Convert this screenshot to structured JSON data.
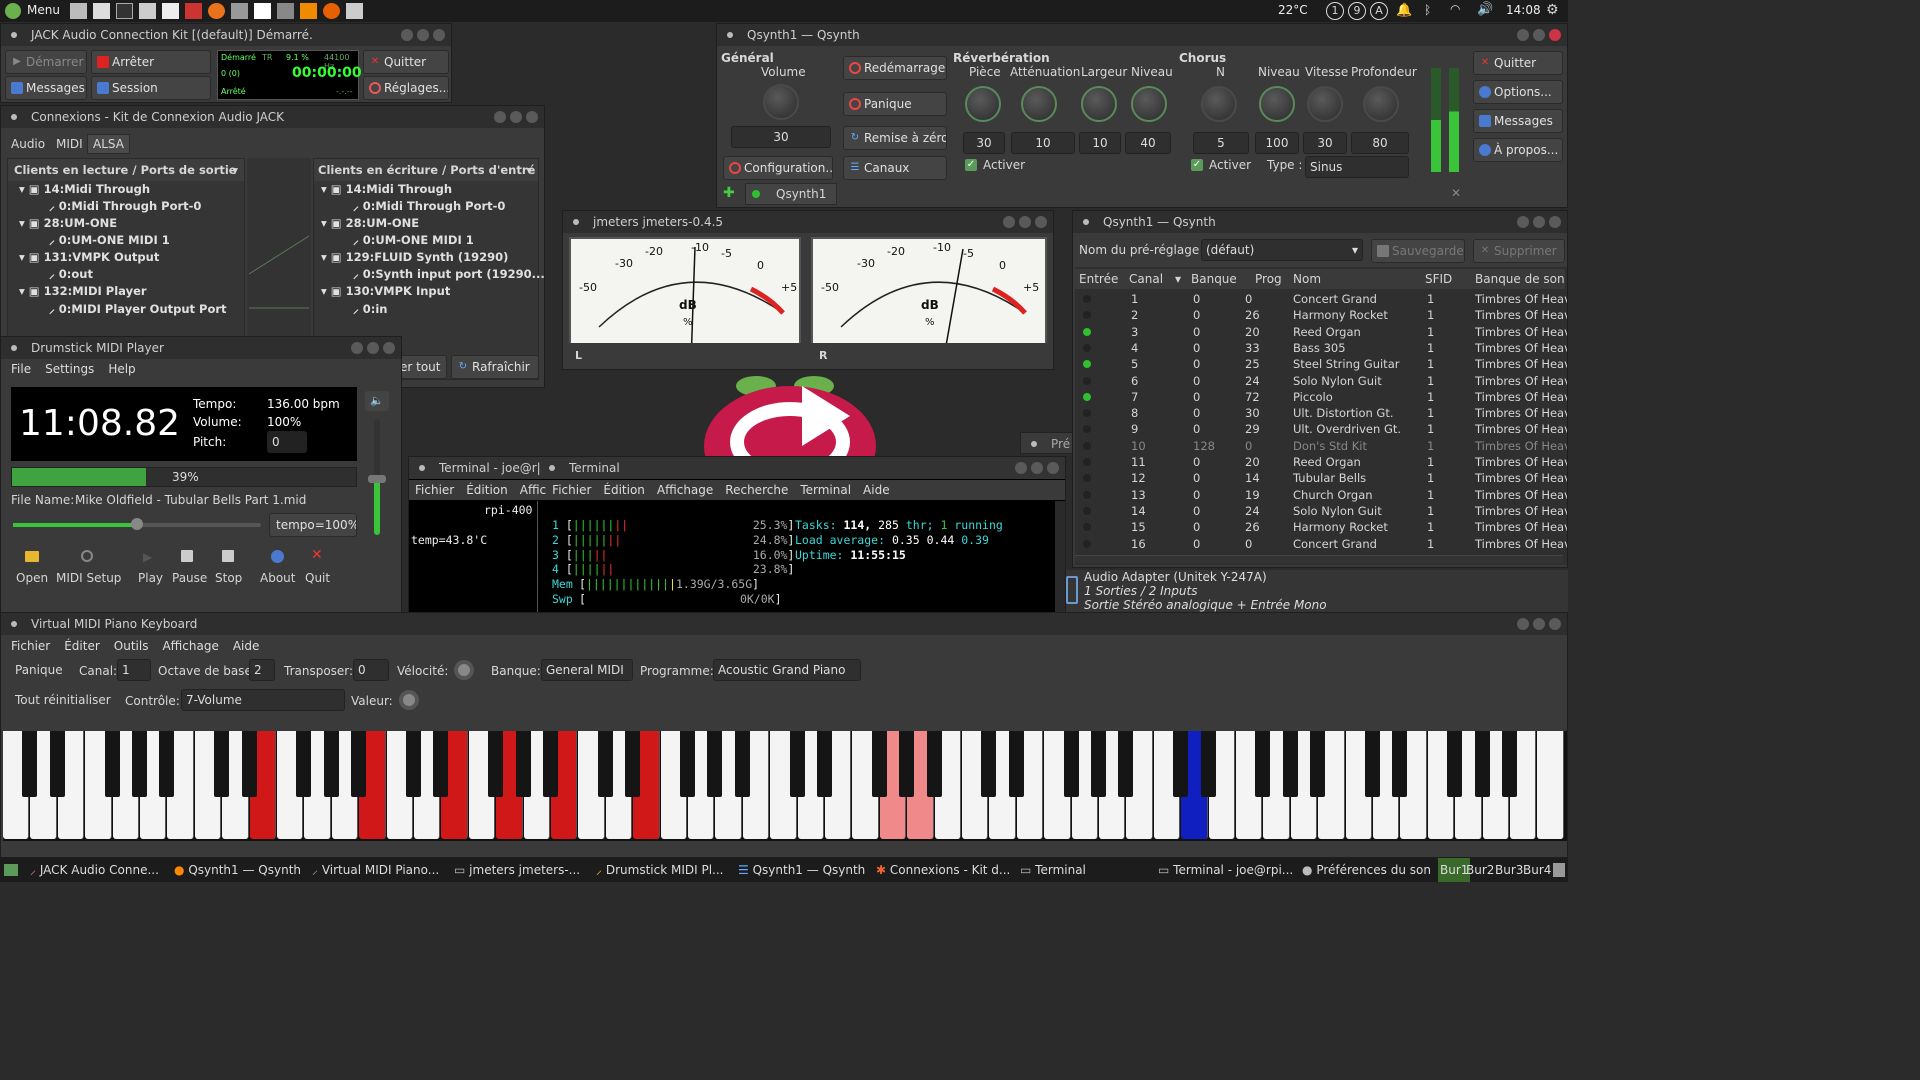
{
  "topbar": {
    "menu": "Menu",
    "temp": "22°C",
    "clock": "14:08",
    "badges": [
      "1",
      "9",
      "A"
    ]
  },
  "jack": {
    "title": "JACK Audio Connection Kit [(default)] Démarré.",
    "start": "Démarrer",
    "stop": "Arrêter",
    "quit": "Quitter",
    "messages": "Messages",
    "session": "Session",
    "settings": "Réglages...",
    "status_started": "Démarré",
    "status_tr": "TR",
    "dsp": "9.1 %",
    "rate": "44100 Hz",
    "xruns": "0 (0)",
    "time": "00:00:00",
    "status_stopped": "Arrêté",
    "latency": "-.-.--"
  },
  "conn": {
    "title": "Connexions - Kit de Connexion Audio JACK",
    "tabs": [
      "Audio",
      "MIDI",
      "ALSA"
    ],
    "readable_header": "Clients en lecture / Ports de sortie",
    "writable_header": "Clients en écriture / Ports d'entré",
    "readable": [
      {
        "client": "14:Midi Through",
        "port": "0:Midi Through Port-0"
      },
      {
        "client": "28:UM-ONE",
        "port": "0:UM-ONE MIDI 1"
      },
      {
        "client": "131:VMPK Output",
        "port": "0:out"
      },
      {
        "client": "132:MIDI Player",
        "port": "0:MIDI Player Output Port"
      }
    ],
    "writable": [
      {
        "client": "14:Midi Through",
        "port": "0:Midi Through Port-0"
      },
      {
        "client": "28:UM-ONE",
        "port": "0:UM-ONE MIDI 1"
      },
      {
        "client": "129:FLUID Synth (19290)",
        "port": "0:Synth input port (19290..."
      },
      {
        "client": "130:VMPK Input",
        "port": "0:in"
      }
    ],
    "disconnect_all": "er tout",
    "refresh": "Rafraîchir"
  },
  "qsynth": {
    "title": "Qsynth1 — Qsynth",
    "general": "Général",
    "volume": "Volume",
    "volume_val": "30",
    "restart": "Redémarrage",
    "panic": "Panique",
    "reset": "Remise à zéro",
    "config": "Configuration...",
    "channels": "Canaux",
    "reverb": "Réverbération",
    "reverb_labels": [
      "Pièce",
      "Atténuation",
      "Largeur",
      "Niveau"
    ],
    "reverb_vals": [
      "30",
      "10",
      "10",
      "40"
    ],
    "chorus": "Chorus",
    "chorus_labels": [
      "N",
      "Niveau",
      "Vitesse",
      "Profondeur"
    ],
    "chorus_vals": [
      "5",
      "100",
      "30",
      "80"
    ],
    "activate": "Activer",
    "type_label": "Type :",
    "type_val": "Sinus",
    "quit": "Quitter",
    "options": "Options...",
    "messages": "Messages",
    "about": "À propos...",
    "engine": "Qsynth1"
  },
  "jmeters": {
    "title": "jmeters  jmeters-0.4.5",
    "scale": [
      "-50",
      "-30",
      "-20",
      "-10",
      "-5",
      "0",
      "+5"
    ],
    "unit": "dB",
    "percent": "%",
    "left": "L",
    "right": "R"
  },
  "channels": {
    "title": "Qsynth1 — Qsynth",
    "preset_label": "Nom du pré-réglage :",
    "preset_val": "(défaut)",
    "save": "Sauvegarder",
    "delete": "Supprimer",
    "headers": [
      "Entrée",
      "Canal",
      "Banque",
      "Prog",
      "Nom",
      "SFID",
      "Banque de son"
    ],
    "rows": [
      {
        "ch": "1",
        "bank": "0",
        "prog": "0",
        "name": "Concert Grand",
        "sfid": "1",
        "sf": "Timbres Of Heav",
        "on": false
      },
      {
        "ch": "2",
        "bank": "0",
        "prog": "26",
        "name": "Harmony Rocket",
        "sfid": "1",
        "sf": "Timbres Of Heav",
        "on": false
      },
      {
        "ch": "3",
        "bank": "0",
        "prog": "20",
        "name": "Reed Organ",
        "sfid": "1",
        "sf": "Timbres Of Heav",
        "on": true
      },
      {
        "ch": "4",
        "bank": "0",
        "prog": "33",
        "name": "Bass 305",
        "sfid": "1",
        "sf": "Timbres Of Heav",
        "on": false
      },
      {
        "ch": "5",
        "bank": "0",
        "prog": "25",
        "name": "Steel String Guitar",
        "sfid": "1",
        "sf": "Timbres Of Heav",
        "on": true
      },
      {
        "ch": "6",
        "bank": "0",
        "prog": "24",
        "name": "Solo Nylon Guit",
        "sfid": "1",
        "sf": "Timbres Of Heav",
        "on": false
      },
      {
        "ch": "7",
        "bank": "0",
        "prog": "72",
        "name": "Piccolo",
        "sfid": "1",
        "sf": "Timbres Of Heav",
        "on": true
      },
      {
        "ch": "8",
        "bank": "0",
        "prog": "30",
        "name": "Ult. Distortion Gt.",
        "sfid": "1",
        "sf": "Timbres Of Heav",
        "on": false
      },
      {
        "ch": "9",
        "bank": "0",
        "prog": "29",
        "name": "Ult. Overdriven Gt.",
        "sfid": "1",
        "sf": "Timbres Of Heav",
        "on": false
      },
      {
        "ch": "10",
        "bank": "128",
        "prog": "0",
        "name": "Don's Std Kit",
        "sfid": "1",
        "sf": "Timbres Of Heav",
        "on": false
      },
      {
        "ch": "11",
        "bank": "0",
        "prog": "20",
        "name": "Reed Organ",
        "sfid": "1",
        "sf": "Timbres Of Heav",
        "on": false
      },
      {
        "ch": "12",
        "bank": "0",
        "prog": "14",
        "name": "Tubular Bells",
        "sfid": "1",
        "sf": "Timbres Of Heav",
        "on": false
      },
      {
        "ch": "13",
        "bank": "0",
        "prog": "19",
        "name": "Church Organ",
        "sfid": "1",
        "sf": "Timbres Of Heav",
        "on": false
      },
      {
        "ch": "14",
        "bank": "0",
        "prog": "24",
        "name": "Solo Nylon Guit",
        "sfid": "1",
        "sf": "Timbres Of Heav",
        "on": false
      },
      {
        "ch": "15",
        "bank": "0",
        "prog": "26",
        "name": "Harmony Rocket",
        "sfid": "1",
        "sf": "Timbres Of Heav",
        "on": false
      },
      {
        "ch": "16",
        "bank": "0",
        "prog": "0",
        "name": "Concert Grand",
        "sfid": "1",
        "sf": "Timbres Of Heav",
        "on": false
      }
    ]
  },
  "audio_adapter": {
    "name": "Audio Adapter (Unitek Y-247A)",
    "io": "1 Sorties / 2 Inputs",
    "desc": "Sortie Stéréo analogique + Entrée Mono"
  },
  "prefs_tab": "Pré",
  "drumstick": {
    "title": "Drumstick MIDI Player",
    "menu": [
      "File",
      "Settings",
      "Help"
    ],
    "time": "11:08.82",
    "tempo_label": "Tempo:",
    "tempo_val": "136.00 bpm",
    "volume_label": "Volume:",
    "volume_val": "100%",
    "pitch_label": "Pitch:",
    "pitch_val": "0",
    "progress": 39,
    "progress_text": "39%",
    "filename_label": "File Name:",
    "filename": "Mike Oldfield - Tubular Bells Part 1.mid",
    "tempo_btn": "tempo=100%",
    "buttons": [
      "Open",
      "MIDI Setup",
      "Play",
      "Pause",
      "Stop",
      "About",
      "Quit"
    ]
  },
  "terminal": {
    "title1": "Terminal - joe@r|",
    "title2": "Terminal",
    "menu1": [
      "Fichier",
      "Édition",
      "Affic"
    ],
    "menu2": [
      "Fichier",
      "Édition",
      "Affichage",
      "Recherche",
      "Terminal",
      "Aide"
    ],
    "host": "rpi-400",
    "temp": "temp=43.8'C",
    "cpus": [
      {
        "n": "1",
        "pct": "25.3%"
      },
      {
        "n": "2",
        "pct": "24.8%"
      },
      {
        "n": "3",
        "pct": "16.0%"
      },
      {
        "n": "4",
        "pct": "23.8%"
      }
    ],
    "mem_label": "Mem",
    "mem_val": "1.39G/3.6",
    "mem_tail": "5G",
    "swp_label": "Swp",
    "swp_val": "0K/0K",
    "tasks_label": "Tasks:",
    "tasks": "114,",
    "thr": "285",
    "thr_label": "thr;",
    "running": "1",
    "running_label": "running",
    "load_label": "Load average:",
    "load1": "0.35",
    "load2": "0.44",
    "load3": "0.39",
    "uptime_label": "Uptime:",
    "uptime": "11:55:15"
  },
  "vmpk": {
    "title": "Virtual MIDI Piano Keyboard",
    "menu": [
      "Fichier",
      "Éditer",
      "Outils",
      "Affichage",
      "Aide"
    ],
    "panic": "Panique",
    "channel_label": "Canal:",
    "channel": "1",
    "octave_label": "Octave de base:",
    "octave": "2",
    "transpose_label": "Transposer:",
    "transpose": "0",
    "velocity_label": "Vélocité:",
    "bank_label": "Banque:",
    "bank": "General MIDI",
    "program_label": "Programme:",
    "program": "Acoustic Grand Piano",
    "reset": "Tout réinitialiser",
    "control_label": "Contrôle:",
    "control": "7-Volume",
    "value_label": "Valeur:"
  },
  "taskbar": {
    "items": [
      "JACK Audio Conne...",
      "Qsynth1 — Qsynth",
      "Virtual MIDI Piano...",
      "jmeters   jmeters-...",
      "Drumstick MIDI Pl...",
      "Qsynth1 — Qsynth",
      "Connexions - Kit d...",
      "Terminal",
      "Terminal - joe@rpi...",
      "Préférences du son"
    ],
    "desktops": [
      "Bur1",
      "Bur2",
      "Bur3",
      "Bur4"
    ]
  },
  "colors": {
    "red_key": "#d01818",
    "pink_key": "#f08a8a",
    "blue_key": "#1020c0",
    "green_led": "#2ec02e"
  }
}
